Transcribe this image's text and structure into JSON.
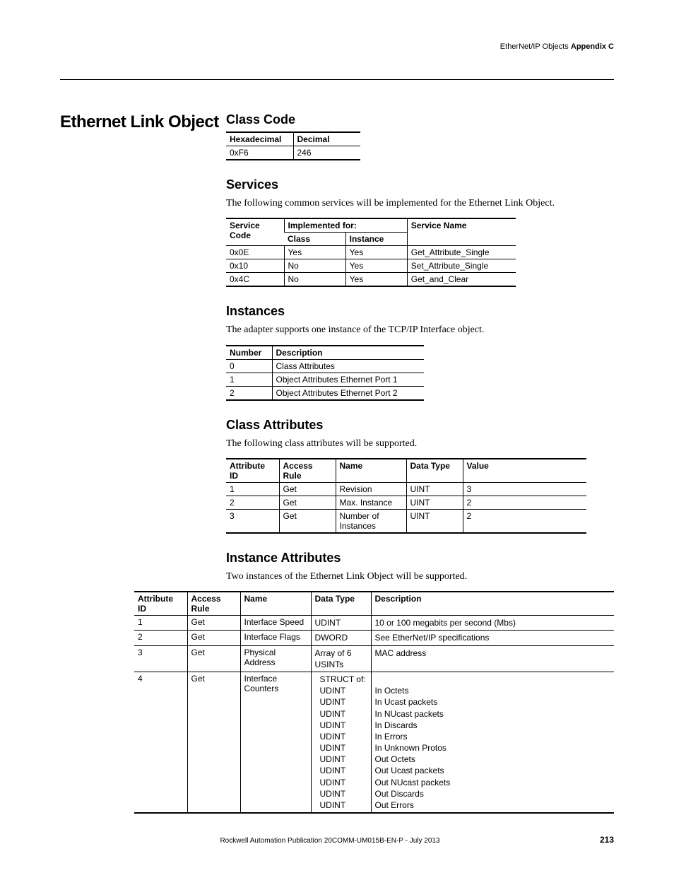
{
  "header": {
    "left": "EtherNet/IP Objects",
    "right": "Appendix C"
  },
  "section_title": "Ethernet Link Object",
  "class_code": {
    "title": "Class Code",
    "headers": [
      "Hexadecimal",
      "Decimal"
    ],
    "row": [
      "0xF6",
      "246"
    ]
  },
  "services": {
    "title": "Services",
    "intro": "The following common services will be implemented for the Ethernet Link Object.",
    "h_service_code": "Service Code",
    "h_impl_for": "Implemented for:",
    "h_service_name": "Service Name",
    "h_class": "Class",
    "h_instance": "Instance",
    "rows": [
      {
        "code": "0x0E",
        "cls": "Yes",
        "inst": "Yes",
        "name": "Get_Attribute_Single"
      },
      {
        "code": "0x10",
        "cls": "No",
        "inst": "Yes",
        "name": "Set_Attribute_Single"
      },
      {
        "code": "0x4C",
        "cls": "No",
        "inst": "Yes",
        "name": "Get_and_Clear"
      }
    ]
  },
  "instances": {
    "title": "Instances",
    "intro": "The adapter supports one instance of the TCP/IP Interface object.",
    "headers": [
      "Number",
      "Description"
    ],
    "rows": [
      {
        "num": "0",
        "desc": "Class Attributes"
      },
      {
        "num": "1",
        "desc": "Object Attributes Ethernet Port 1"
      },
      {
        "num": "2",
        "desc": "Object Attributes Ethernet Port 2"
      }
    ]
  },
  "class_attrs": {
    "title": "Class Attributes",
    "intro": "The following class attributes will be supported.",
    "headers": [
      "Attribute ID",
      "Access Rule",
      "Name",
      "Data Type",
      "Value"
    ],
    "rows": [
      {
        "id": "1",
        "ar": "Get",
        "nm": "Revision",
        "dt": "UINT",
        "val": "3"
      },
      {
        "id": "2",
        "ar": "Get",
        "nm": "Max. Instance",
        "dt": "UINT",
        "val": "2"
      },
      {
        "id": "3",
        "ar": "Get",
        "nm": "Number of Instances",
        "dt": "UINT",
        "val": "2"
      }
    ]
  },
  "inst_attrs": {
    "title": "Instance Attributes",
    "intro": "Two instances of the Ethernet Link Object will be supported.",
    "headers": [
      "Attribute ID",
      "Access Rule",
      "Name",
      "Data Type",
      "Description"
    ],
    "rows": [
      {
        "id": "1",
        "ar": "Get",
        "nm": "Interface Speed",
        "dt": "UDINT",
        "desc": "10 or 100 megabits per second (Mbs)"
      },
      {
        "id": "2",
        "ar": "Get",
        "nm": "Interface Flags",
        "dt": "DWORD",
        "desc": "See EtherNet/IP specifications"
      },
      {
        "id": "3",
        "ar": "Get",
        "nm": "Physical Address",
        "dt": "Array of 6\nUSINTs",
        "desc": "MAC address"
      },
      {
        "id": "4",
        "ar": "Get",
        "nm": "Interface Counters",
        "dt": "STRUCT of:\nUDINT\nUDINT\nUDINT\nUDINT\nUDINT\nUDINT\nUDINT\nUDINT\nUDINT\nUDINT\nUDINT",
        "desc": "\nIn Octets\nIn Ucast packets\nIn NUcast packets\nIn Discards\nIn Errors\nIn Unknown Protos\nOut Octets\nOut Ucast packets\nOut NUcast packets\nOut Discards\nOut Errors"
      }
    ]
  },
  "footer": {
    "pub": "Rockwell Automation Publication  20COMM-UM015B-EN-P - July 2013",
    "page": "213"
  }
}
